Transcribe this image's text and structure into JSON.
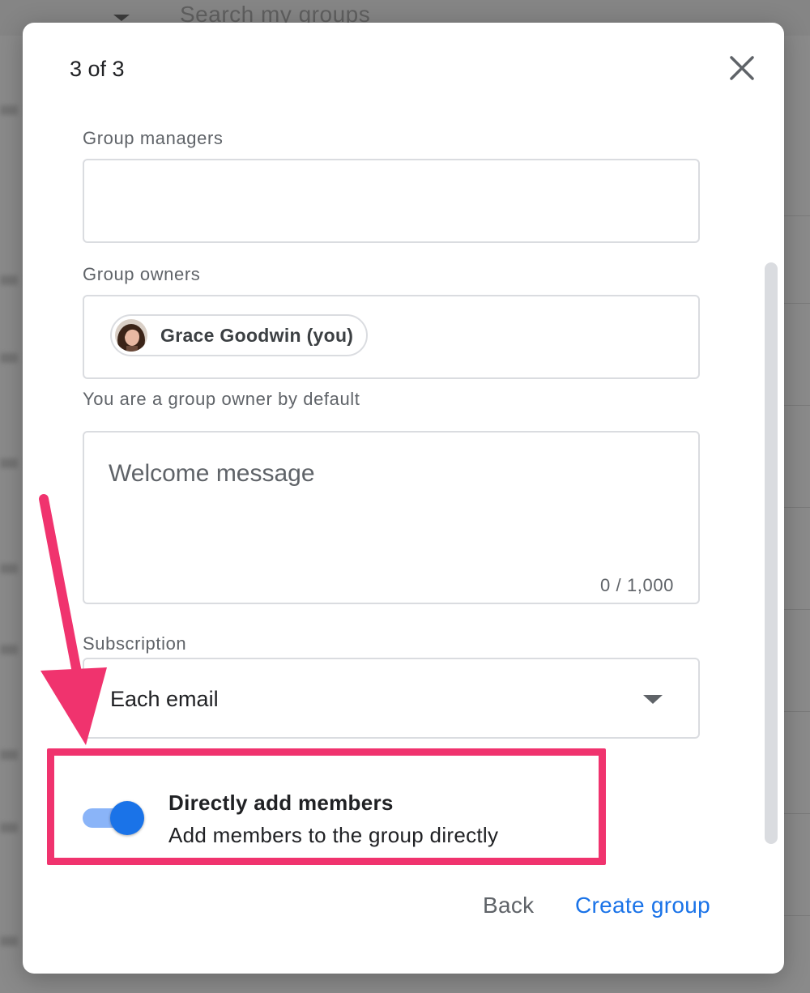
{
  "background": {
    "search_placeholder": "Search my groups"
  },
  "dialog": {
    "step": "3 of 3",
    "close_icon": "close-icon",
    "group_managers_label": "Group managers",
    "group_managers_value": "",
    "group_owners_label": "Group owners",
    "owner_chip": "Grace Goodwin (you)",
    "owner_helper": "You are a group owner by default",
    "welcome_placeholder": "Welcome message",
    "welcome_counter": "0 / 1,000",
    "subscription_label": "Subscription",
    "subscription_value": "Each email",
    "direct_add_title": "Directly add members",
    "direct_add_subtitle": "Add members to the group directly",
    "direct_add_enabled": true,
    "back_label": "Back",
    "create_label": "Create group"
  },
  "colors": {
    "accent": "#1a73e8",
    "toggle_track": "#8ab4f8",
    "annotation": "#f0336e"
  }
}
